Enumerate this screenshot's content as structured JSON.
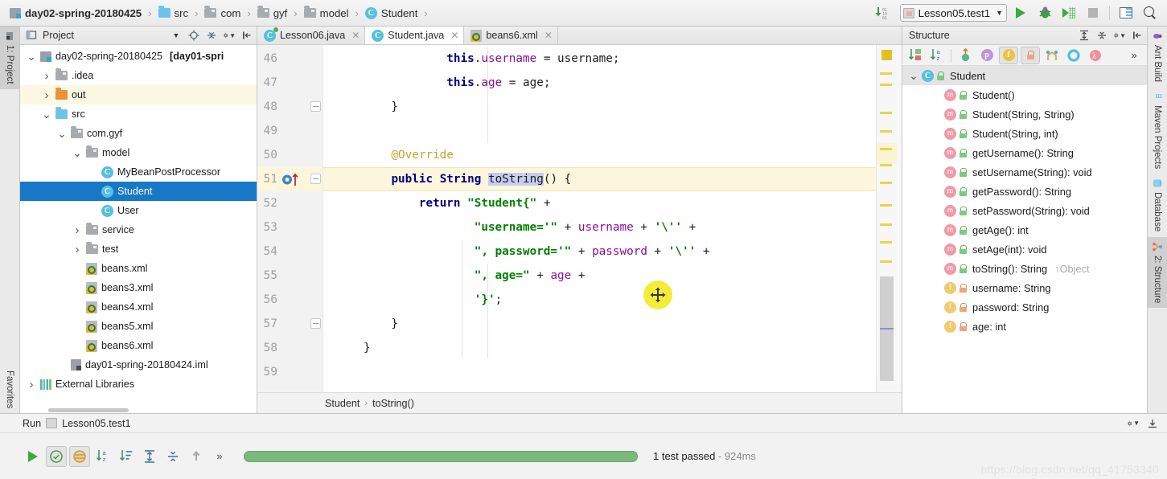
{
  "app": {
    "breadcrumb": [
      {
        "label": "day02-spring-20180425",
        "icon": "module-icon",
        "bold": true
      },
      {
        "label": "src",
        "icon": "folder-blue-icon",
        "bold": false
      },
      {
        "label": "com",
        "icon": "folder-gray-icon",
        "bold": false
      },
      {
        "label": "gyf",
        "icon": "folder-gray-icon",
        "bold": false
      },
      {
        "label": "model",
        "icon": "folder-gray-icon",
        "bold": false
      },
      {
        "label": "Student",
        "icon": "class-icon",
        "bold": false
      }
    ],
    "run_configuration": "Lesson05.test1",
    "toolbar_buttons": [
      "run-button",
      "debug-button",
      "run-with-coverage-button",
      "stop-button",
      "layout-button",
      "search-everywhere-button"
    ]
  },
  "left_strip": {
    "top_tab": "1: Project",
    "bottom_tab": "Favorites"
  },
  "right_strip": {
    "tabs": [
      "Ant Build",
      "Maven Projects",
      "Database",
      "2: Structure"
    ]
  },
  "project_panel": {
    "title": "Project",
    "tree": [
      {
        "label": "day02-spring-20180425",
        "suffix": "[day01-spri",
        "icon": "module-icon",
        "indent": 0,
        "arrow": "down",
        "bold_suffix": true,
        "selected": false,
        "highlight": false
      },
      {
        "label": ".idea",
        "icon": "folder-gray-icon",
        "indent": 1,
        "arrow": "right",
        "selected": false,
        "highlight": false
      },
      {
        "label": "out",
        "icon": "folder-orange-icon",
        "indent": 1,
        "arrow": "right",
        "selected": false,
        "highlight": true
      },
      {
        "label": "src",
        "icon": "folder-blue-icon",
        "indent": 1,
        "arrow": "down",
        "selected": false,
        "highlight": false
      },
      {
        "label": "com.gyf",
        "icon": "folder-gray-icon",
        "indent": 2,
        "arrow": "down",
        "selected": false,
        "highlight": false
      },
      {
        "label": "model",
        "icon": "folder-gray-icon",
        "indent": 3,
        "arrow": "down",
        "selected": false,
        "highlight": false
      },
      {
        "label": "MyBeanPostProcessor",
        "icon": "class-icon",
        "indent": 4,
        "arrow": "none",
        "selected": false,
        "highlight": false
      },
      {
        "label": "Student",
        "icon": "class-icon",
        "indent": 4,
        "arrow": "none",
        "selected": true,
        "highlight": false
      },
      {
        "label": "User",
        "icon": "class-icon",
        "indent": 4,
        "arrow": "none",
        "selected": false,
        "highlight": false
      },
      {
        "label": "service",
        "icon": "folder-gray-icon",
        "indent": 3,
        "arrow": "right",
        "selected": false,
        "highlight": false
      },
      {
        "label": "test",
        "icon": "folder-gray-icon",
        "indent": 3,
        "arrow": "right",
        "selected": false,
        "highlight": false
      },
      {
        "label": "beans.xml",
        "icon": "xml-icon",
        "indent": 3,
        "arrow": "none",
        "selected": false,
        "highlight": false
      },
      {
        "label": "beans3.xml",
        "icon": "xml-icon",
        "indent": 3,
        "arrow": "none",
        "selected": false,
        "highlight": false
      },
      {
        "label": "beans4.xml",
        "icon": "xml-icon",
        "indent": 3,
        "arrow": "none",
        "selected": false,
        "highlight": false
      },
      {
        "label": "beans5.xml",
        "icon": "xml-icon",
        "indent": 3,
        "arrow": "none",
        "selected": false,
        "highlight": false
      },
      {
        "label": "beans6.xml",
        "icon": "xml-icon",
        "indent": 3,
        "arrow": "none",
        "selected": false,
        "highlight": false
      },
      {
        "label": "day01-spring-20180424.iml",
        "icon": "iml-icon",
        "indent": 2,
        "arrow": "none",
        "selected": false,
        "highlight": false
      },
      {
        "label": "External Libraries",
        "icon": "library-icon",
        "indent": 0,
        "arrow": "right",
        "selected": false,
        "highlight": false
      }
    ]
  },
  "editor": {
    "tabs": [
      {
        "label": "Lesson06.java",
        "icon": "class-run-icon",
        "active": false
      },
      {
        "label": "Student.java",
        "icon": "class-icon",
        "active": true
      },
      {
        "label": "beans6.xml",
        "icon": "xml-icon",
        "active": false
      }
    ],
    "first_line_number": 46,
    "last_line_number": 59,
    "breadcrumb": [
      "Student",
      "toString()"
    ],
    "lines": [
      {
        "n": 46,
        "tokens": [
          {
            "t": "            ",
            "c": "p"
          },
          {
            "t": "this",
            "c": "k"
          },
          {
            "t": ".",
            "c": "p"
          },
          {
            "t": "username",
            "c": "f"
          },
          {
            "t": " = username;",
            "c": "p"
          }
        ]
      },
      {
        "n": 47,
        "tokens": [
          {
            "t": "            ",
            "c": "p"
          },
          {
            "t": "this",
            "c": "k"
          },
          {
            "t": ".",
            "c": "p"
          },
          {
            "t": "age",
            "c": "f"
          },
          {
            "t": " = age;",
            "c": "p"
          }
        ]
      },
      {
        "n": 48,
        "tokens": [
          {
            "t": "    }",
            "c": "p"
          }
        ]
      },
      {
        "n": 49,
        "tokens": []
      },
      {
        "n": 50,
        "tokens": [
          {
            "t": "    @Override",
            "c": "ann"
          }
        ]
      },
      {
        "n": 51,
        "tokens": [
          {
            "t": "    ",
            "c": "p"
          },
          {
            "t": "public",
            "c": "k"
          },
          {
            "t": " ",
            "c": "p"
          },
          {
            "t": "String",
            "c": "k"
          },
          {
            "t": " ",
            "c": "p"
          },
          {
            "t": "toString",
            "c": "sel"
          },
          {
            "t": "() {",
            "c": "p"
          }
        ]
      },
      {
        "n": 52,
        "tokens": [
          {
            "t": "        ",
            "c": "p"
          },
          {
            "t": "return",
            "c": "k"
          },
          {
            "t": " ",
            "c": "p"
          },
          {
            "t": "\"Student{\"",
            "c": "s"
          },
          {
            "t": " +",
            "c": "p"
          }
        ]
      },
      {
        "n": 53,
        "tokens": [
          {
            "t": "                ",
            "c": "p"
          },
          {
            "t": "\"username='\"",
            "c": "s"
          },
          {
            "t": " + ",
            "c": "p"
          },
          {
            "t": "username",
            "c": "f"
          },
          {
            "t": " + ",
            "c": "p"
          },
          {
            "t": "'\\''",
            "c": "s"
          },
          {
            "t": " +",
            "c": "p"
          }
        ]
      },
      {
        "n": 54,
        "tokens": [
          {
            "t": "                ",
            "c": "p"
          },
          {
            "t": "\", password='\"",
            "c": "s"
          },
          {
            "t": " + ",
            "c": "p"
          },
          {
            "t": "password",
            "c": "f"
          },
          {
            "t": " + ",
            "c": "p"
          },
          {
            "t": "'\\''",
            "c": "s"
          },
          {
            "t": " +",
            "c": "p"
          }
        ]
      },
      {
        "n": 55,
        "tokens": [
          {
            "t": "                ",
            "c": "p"
          },
          {
            "t": "\", age=\"",
            "c": "s"
          },
          {
            "t": " + ",
            "c": "p"
          },
          {
            "t": "age",
            "c": "f"
          },
          {
            "t": " +",
            "c": "p"
          }
        ]
      },
      {
        "n": 56,
        "tokens": [
          {
            "t": "                ",
            "c": "p"
          },
          {
            "t": "'}'",
            "c": "s"
          },
          {
            "t": ";",
            "c": "p"
          }
        ]
      },
      {
        "n": 57,
        "tokens": [
          {
            "t": "    }",
            "c": "p"
          }
        ]
      },
      {
        "n": 58,
        "tokens": [
          {
            "t": "}",
            "c": "p"
          }
        ]
      },
      {
        "n": 59,
        "tokens": []
      }
    ],
    "cursor_line": 51,
    "drag_cursor_icon": "move-cursor-icon"
  },
  "structure_panel": {
    "title": "Structure",
    "toolbar": [
      {
        "name": "sort-by-visibility-button",
        "on": false
      },
      {
        "name": "sort-alphabetically-button",
        "on": false
      },
      {
        "name": "show-inherited-button",
        "on": false
      },
      {
        "name": "show-properties-button",
        "on": false
      },
      {
        "name": "show-fields-button",
        "on": true
      },
      {
        "name": "show-non-public-button",
        "on": true
      },
      {
        "name": "show-anonymous-classes-button",
        "on": false
      },
      {
        "name": "show-interfaces-button",
        "on": false
      },
      {
        "name": "show-lambdas-button",
        "on": false
      },
      {
        "name": "expand-toolbar-button",
        "on": false
      }
    ],
    "tree": [
      {
        "label": "Student",
        "kind": "class",
        "indent": 0,
        "arrow": "down",
        "selected": true,
        "lock": "green",
        "override": ""
      },
      {
        "label": "Student()",
        "kind": "method",
        "indent": 1,
        "arrow": "none",
        "selected": false,
        "lock": "green",
        "override": ""
      },
      {
        "label": "Student(String, String)",
        "kind": "method",
        "indent": 1,
        "arrow": "none",
        "selected": false,
        "lock": "green",
        "override": ""
      },
      {
        "label": "Student(String, int)",
        "kind": "method",
        "indent": 1,
        "arrow": "none",
        "selected": false,
        "lock": "green",
        "override": ""
      },
      {
        "label": "getUsername(): String",
        "kind": "method",
        "indent": 1,
        "arrow": "none",
        "selected": false,
        "lock": "green",
        "override": ""
      },
      {
        "label": "setUsername(String): void",
        "kind": "method",
        "indent": 1,
        "arrow": "none",
        "selected": false,
        "lock": "green",
        "override": ""
      },
      {
        "label": "getPassword(): String",
        "kind": "method",
        "indent": 1,
        "arrow": "none",
        "selected": false,
        "lock": "green",
        "override": ""
      },
      {
        "label": "setPassword(String): void",
        "kind": "method",
        "indent": 1,
        "arrow": "none",
        "selected": false,
        "lock": "green",
        "override": ""
      },
      {
        "label": "getAge(): int",
        "kind": "method",
        "indent": 1,
        "arrow": "none",
        "selected": false,
        "lock": "green",
        "override": ""
      },
      {
        "label": "setAge(int): void",
        "kind": "method",
        "indent": 1,
        "arrow": "none",
        "selected": false,
        "lock": "green",
        "override": ""
      },
      {
        "label": "toString(): String",
        "kind": "method",
        "indent": 1,
        "arrow": "none",
        "selected": false,
        "lock": "green",
        "override": "↑Object"
      },
      {
        "label": "username: String",
        "kind": "field",
        "indent": 1,
        "arrow": "none",
        "selected": false,
        "lock": "orange",
        "override": ""
      },
      {
        "label": "password: String",
        "kind": "field",
        "indent": 1,
        "arrow": "none",
        "selected": false,
        "lock": "orange",
        "override": ""
      },
      {
        "label": "age: int",
        "kind": "field",
        "indent": 1,
        "arrow": "none",
        "selected": false,
        "lock": "orange",
        "override": ""
      }
    ]
  },
  "run_panel": {
    "title": "Run",
    "config_label": "Lesson05.test1",
    "buttons": [
      {
        "name": "rerun-button",
        "on": false
      },
      {
        "name": "show-passed-button",
        "on": true
      },
      {
        "name": "show-ignored-button",
        "on": true
      },
      {
        "name": "sort-alphabetically-button",
        "on": false
      },
      {
        "name": "sort-by-duration-button",
        "on": false
      },
      {
        "name": "expand-all-button",
        "on": false
      },
      {
        "name": "collapse-all-button",
        "on": false
      },
      {
        "name": "previous-occurrence-button",
        "on": false
      },
      {
        "name": "more-button",
        "on": false
      }
    ],
    "progress_percent": 100,
    "status_text": "1 test passed",
    "duration": "- 924ms"
  },
  "watermark": "https://blog.csdn.net/qq_41753340",
  "colors": {
    "accent_blue": "#1878c8",
    "keyword": "#000083",
    "string": "#008000",
    "field": "#871094",
    "annotation": "#c8a22a",
    "pass_green": "#7cb87c",
    "highlight_row": "#fdf6dd"
  }
}
